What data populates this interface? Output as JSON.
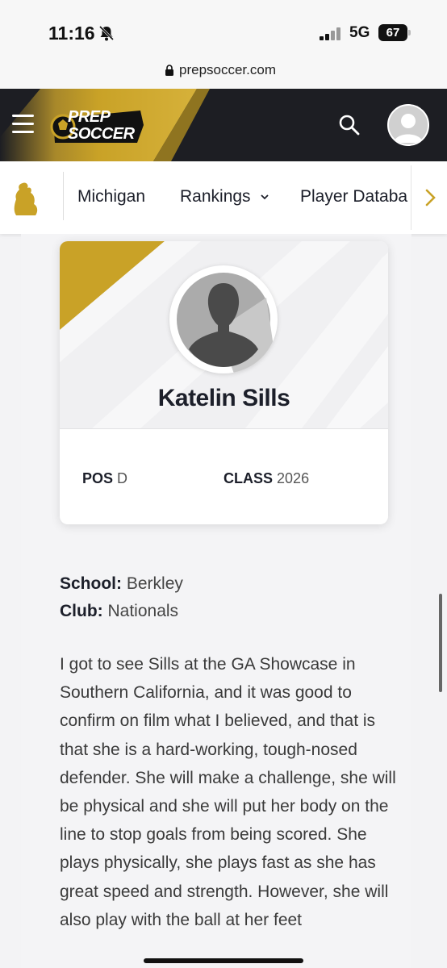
{
  "status_bar": {
    "time": "11:16",
    "network": "5G",
    "battery": "67"
  },
  "url_bar": {
    "url": "prepsoccer.com"
  },
  "header": {
    "logo_line1": "PREP",
    "logo_line2": "SOCCER"
  },
  "nav": {
    "items": [
      {
        "label": "Michigan"
      },
      {
        "label": "Rankings"
      },
      {
        "label": "Player Databa"
      }
    ]
  },
  "player": {
    "name": "Katelin Sills",
    "pos_label": "POS",
    "pos_value": "D",
    "class_label": "CLASS",
    "class_value": "2026",
    "school_label": "School:",
    "school_value": "Berkley",
    "club_label": "Club:",
    "club_value": "Nationals"
  },
  "article": {
    "text": "I got to see Sills at the GA Showcase in Southern California, and it was good to confirm on film what I believed, and that is that she is a hard-working, tough-nosed defender. She will make a challenge, she will be physical and she will put her body on the line to stop goals from being scored. She plays physically, she plays fast as she has great speed and strength. However, she will also play with the ball at her feet"
  },
  "colors": {
    "brand_gold": "#c9a227",
    "header_dark": "#1d1e23"
  }
}
